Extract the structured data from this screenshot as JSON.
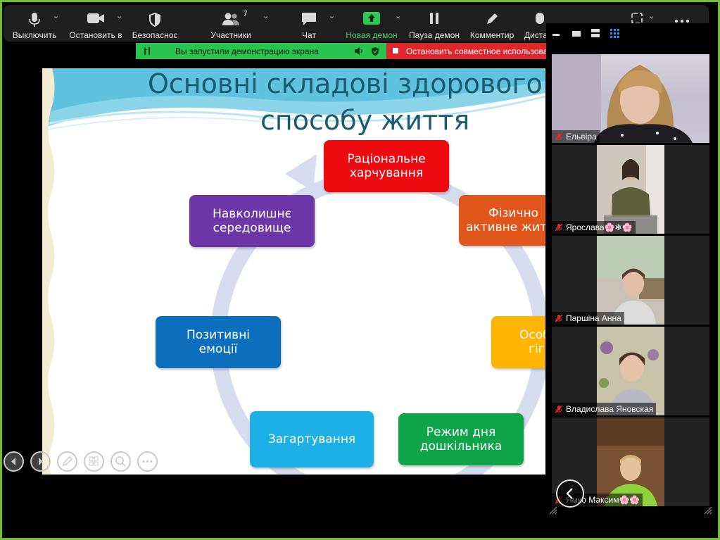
{
  "toolbar": {
    "mute": "Выключить",
    "stop_video": "Остановить в",
    "security": "Безопаснос",
    "participants": "Участники",
    "participants_count": "7",
    "chat": "Чат",
    "new_share": "Новая демон",
    "pause_share": "Пауза демон",
    "annotate": "Комментир",
    "remote": "Диста"
  },
  "banner": {
    "sharing": "Вы запустили демонстрацию экрана",
    "stop": "Остановить совместное использова"
  },
  "slide": {
    "title_line1": "Основні складові здорового",
    "title_line2": "способу життя",
    "items": [
      {
        "label": "Раціональне\nхарчування",
        "color": "#ef0a12"
      },
      {
        "label": "Фізично\nактивне життя",
        "color": "#e0561a"
      },
      {
        "label": "Особиста\nгігієна",
        "color": "#ffb400"
      },
      {
        "label": "Режим дня\nдошкільника",
        "color": "#10a44a"
      },
      {
        "label": "Загартування",
        "color": "#1db0e6"
      },
      {
        "label": "Позитивні\nемоції",
        "color": "#0b6fbd"
      },
      {
        "label": "Навколишнє\nсередовище",
        "color": "#6d36a8"
      }
    ]
  },
  "participants": [
    {
      "name": "Ельвіра"
    },
    {
      "name": "Ярослава🌸❄🌸"
    },
    {
      "name": "Паршіна Анна"
    },
    {
      "name": "Владислава Яновская"
    },
    {
      "name": "Ямко Максим🌸🌸"
    }
  ]
}
